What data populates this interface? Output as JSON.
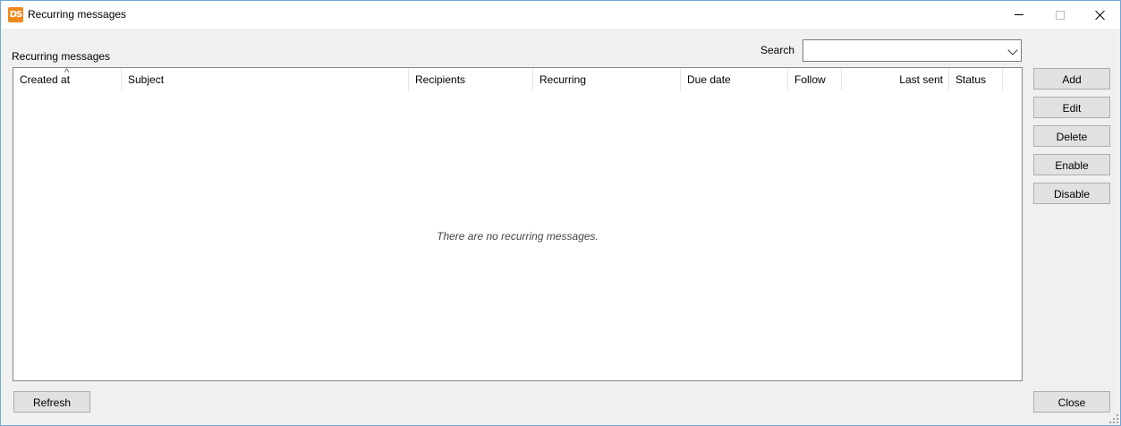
{
  "window": {
    "icon_text": "DS",
    "title": "Recurring messages"
  },
  "section_label": "Recurring messages",
  "search": {
    "label": "Search",
    "value": ""
  },
  "table": {
    "columns": [
      "Created at",
      "Subject",
      "Recipients",
      "Recurring",
      "Due date",
      "Follow",
      "Last sent",
      "Status"
    ],
    "sort_indicator": "^",
    "rows": [],
    "empty_message": "There are no recurring messages."
  },
  "buttons": {
    "add": "Add",
    "edit": "Edit",
    "delete": "Delete",
    "enable": "Enable",
    "disable": "Disable",
    "refresh": "Refresh",
    "close": "Close"
  },
  "icons": [
    "app-icon",
    "minimize-icon",
    "maximize-icon",
    "close-icon",
    "chevron-down-icon",
    "sort-ascending-icon",
    "resize-grip-icon"
  ]
}
